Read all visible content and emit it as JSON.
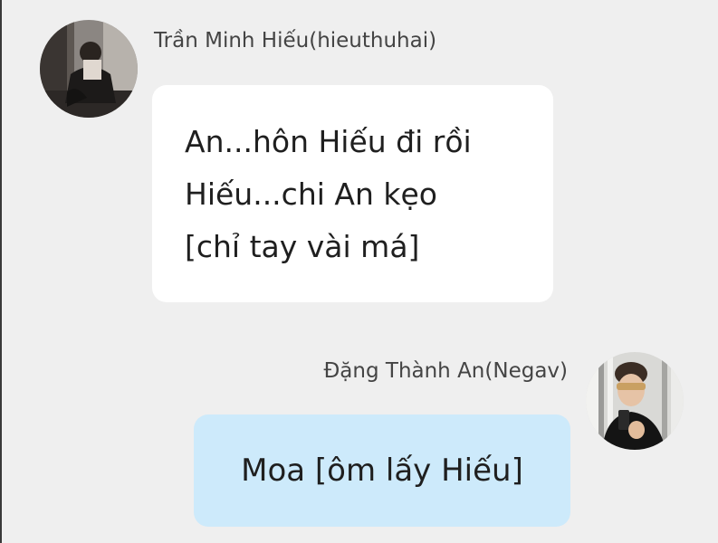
{
  "chat": {
    "messages": [
      {
        "sender": "Trần Minh Hiếu(hieuthuhai)",
        "avatar_icon": "user-avatar-hieuthuhai",
        "lines": [
          "An...hôn Hiếu đi rồi",
          "Hiếu...chi An kẹo",
          "[chỉ tay vài má]"
        ],
        "bubble_color": "#ffffff",
        "align": "left"
      },
      {
        "sender": "Đặng Thành An(Negav)",
        "avatar_icon": "user-avatar-negav",
        "lines": [
          "Moa [ôm lấy Hiếu]"
        ],
        "bubble_color": "#cdeafb",
        "align": "right"
      }
    ]
  }
}
